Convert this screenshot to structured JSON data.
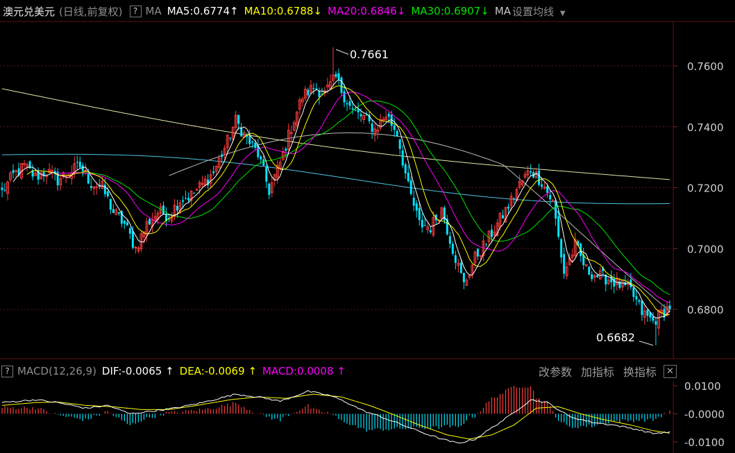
{
  "top_bar": {
    "title": "澳元兑美元",
    "subtitle": "(日线,前复权)",
    "help": "?",
    "ma_label": "MA",
    "ma_items": [
      {
        "text": "MA5:0.6774",
        "arrow": "↑",
        "color": "#ffffff"
      },
      {
        "text": "MA10:0.6788",
        "arrow": "↓",
        "color": "#ffff00"
      },
      {
        "text": "MA20:0.6846",
        "arrow": "↓",
        "color": "#ff00ff"
      },
      {
        "text": "MA30:0.6907",
        "arrow": "↓",
        "color": "#00e600"
      },
      {
        "text": "MA",
        "arrow": "",
        "color": "#c8c8c8"
      }
    ],
    "settings_label": "设置均线",
    "settings_icon": "caret-down-icon"
  },
  "macd_bar": {
    "help": "?",
    "name": "MACD(12,26,9)",
    "dif": "DIF:-0.0065",
    "dif_arrow": "↑",
    "dea": "DEA:-0.0069",
    "dea_arrow": "↑",
    "macd": "MACD:0.0008",
    "macd_arrow": "↑",
    "tools": [
      "改参数",
      "加指标",
      "换指标"
    ],
    "close": "✕"
  },
  "colors": {
    "up": "#ff3c3c",
    "down": "#00e5ff",
    "ma5": "#ffffff",
    "ma10": "#ffff00",
    "ma20": "#ff00ff",
    "ma30": "#00e600",
    "ma_long1": "#e5e5a8",
    "ma_long2": "#4fc3e6",
    "ma_long3": "#bbbbbb",
    "grid": "#4a1a1a"
  },
  "chart_data": [
    {
      "type": "candlestick",
      "title": "澳元兑美元",
      "y_ticks": [
        "0.7600",
        "0.7400",
        "0.7200",
        "0.7000",
        "0.6800"
      ],
      "ylim": [
        0.665,
        0.769
      ],
      "annotations": [
        {
          "label": "0.7661",
          "value": 0.7661,
          "at": "max"
        },
        {
          "label": "0.6682",
          "value": 0.6682,
          "at": "min"
        }
      ],
      "series": [
        {
          "name": "MA5:0.6774"
        },
        {
          "name": "MA10:0.6788"
        },
        {
          "name": "MA20:0.6846"
        },
        {
          "name": "MA30:0.6907"
        }
      ],
      "close_path": [
        [
          0,
          0.7185
        ],
        [
          4,
          0.724
        ],
        [
          8,
          0.727
        ],
        [
          12,
          0.7235
        ],
        [
          16,
          0.7255
        ],
        [
          20,
          0.7225
        ],
        [
          24,
          0.725
        ],
        [
          28,
          0.727
        ],
        [
          32,
          0.7215
        ],
        [
          36,
          0.72
        ],
        [
          40,
          0.712
        ],
        [
          44,
          0.708
        ],
        [
          48,
          0.7
        ],
        [
          52,
          0.708
        ],
        [
          56,
          0.712
        ],
        [
          60,
          0.711
        ],
        [
          64,
          0.716
        ],
        [
          68,
          0.7175
        ],
        [
          72,
          0.721
        ],
        [
          76,
          0.725
        ],
        [
          80,
          0.733
        ],
        [
          84,
          0.742
        ],
        [
          88,
          0.736
        ],
        [
          92,
          0.731
        ],
        [
          96,
          0.719
        ],
        [
          100,
          0.728
        ],
        [
          104,
          0.74
        ],
        [
          108,
          0.75
        ],
        [
          112,
          0.753
        ],
        [
          116,
          0.751
        ],
        [
          120,
          0.756
        ],
        [
          122,
          0.752
        ],
        [
          126,
          0.745
        ],
        [
          130,
          0.743
        ],
        [
          134,
          0.739
        ],
        [
          138,
          0.744
        ],
        [
          142,
          0.738
        ],
        [
          146,
          0.72
        ],
        [
          150,
          0.708
        ],
        [
          154,
          0.707
        ],
        [
          158,
          0.713
        ],
        [
          162,
          0.7
        ],
        [
          166,
          0.688
        ],
        [
          170,
          0.697
        ],
        [
          174,
          0.702
        ],
        [
          178,
          0.708
        ],
        [
          182,
          0.714
        ],
        [
          186,
          0.721
        ],
        [
          190,
          0.726
        ],
        [
          194,
          0.722
        ],
        [
          198,
          0.715
        ],
        [
          202,
          0.692
        ],
        [
          206,
          0.701
        ],
        [
          210,
          0.693
        ],
        [
          214,
          0.691
        ],
        [
          218,
          0.69
        ],
        [
          222,
          0.688
        ],
        [
          226,
          0.686
        ],
        [
          230,
          0.679
        ],
        [
          234,
          0.676
        ],
        [
          238,
          0.6795
        ],
        [
          240,
          0.681
        ]
      ],
      "macd": {
        "y_ticks": [
          "0.0100",
          "-0.0000",
          "-0.0100"
        ],
        "ylim": [
          -0.012,
          0.012
        ],
        "dif_path": [
          [
            0,
            0.004
          ],
          [
            12,
            0.005
          ],
          [
            20,
            0.004
          ],
          [
            30,
            0.002
          ],
          [
            38,
            0.003
          ],
          [
            46,
            0.0
          ],
          [
            54,
            0.001
          ],
          [
            62,
            0.002
          ],
          [
            72,
            0.004
          ],
          [
            84,
            0.007
          ],
          [
            92,
            0.006
          ],
          [
            100,
            0.0045
          ],
          [
            110,
            0.008
          ],
          [
            118,
            0.0065
          ],
          [
            124,
            0.004
          ],
          [
            130,
            0.001
          ],
          [
            136,
            -0.001
          ],
          [
            144,
            -0.004
          ],
          [
            152,
            -0.007
          ],
          [
            158,
            -0.009
          ],
          [
            164,
            -0.0105
          ],
          [
            170,
            -0.009
          ],
          [
            176,
            -0.005
          ],
          [
            182,
            -0.001
          ],
          [
            190,
            0.005
          ],
          [
            196,
            0.004
          ],
          [
            204,
            -0.001
          ],
          [
            212,
            -0.003
          ],
          [
            220,
            -0.004
          ],
          [
            228,
            -0.0055
          ],
          [
            234,
            -0.007
          ],
          [
            240,
            -0.0065
          ]
        ],
        "dea_path": [
          [
            0,
            0.003
          ],
          [
            12,
            0.004
          ],
          [
            20,
            0.0042
          ],
          [
            30,
            0.003
          ],
          [
            40,
            0.0025
          ],
          [
            50,
            0.0015
          ],
          [
            60,
            0.0015
          ],
          [
            70,
            0.003
          ],
          [
            82,
            0.005
          ],
          [
            92,
            0.006
          ],
          [
            102,
            0.0055
          ],
          [
            112,
            0.007
          ],
          [
            122,
            0.006
          ],
          [
            132,
            0.003
          ],
          [
            140,
            0.0
          ],
          [
            150,
            -0.004
          ],
          [
            160,
            -0.0075
          ],
          [
            168,
            -0.009
          ],
          [
            176,
            -0.0075
          ],
          [
            184,
            -0.004
          ],
          [
            192,
            0.002
          ],
          [
            200,
            0.0025
          ],
          [
            208,
            0.0
          ],
          [
            216,
            -0.002
          ],
          [
            226,
            -0.004
          ],
          [
            234,
            -0.006
          ],
          [
            240,
            -0.0069
          ]
        ]
      }
    }
  ]
}
